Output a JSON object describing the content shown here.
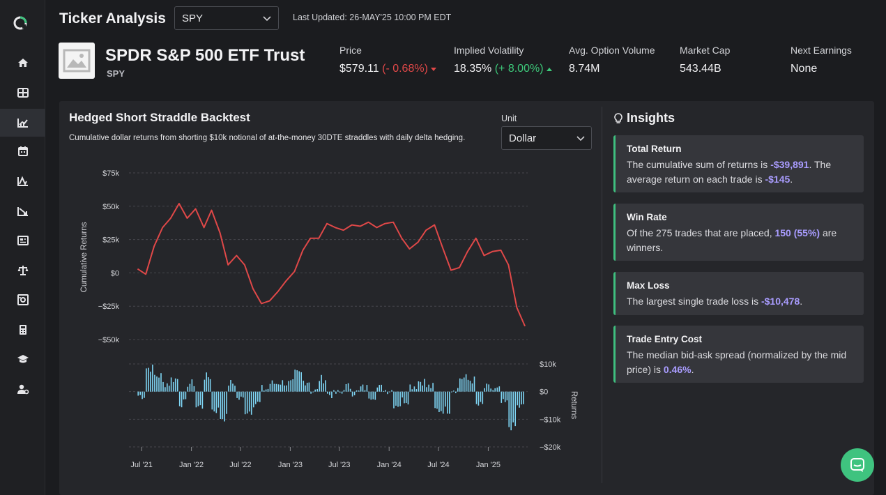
{
  "app": {
    "page_title": "Ticker Analysis",
    "ticker_select": "SPY",
    "last_updated": "Last Updated: 26-MAY'25 10:00 PM EDT"
  },
  "sidebar": {
    "items": [
      {
        "icon": "home-icon"
      },
      {
        "icon": "dashboard-icon"
      },
      {
        "icon": "ticker-analysis-icon",
        "active": true
      },
      {
        "icon": "calendar-icon"
      },
      {
        "icon": "line-chart-icon"
      },
      {
        "icon": "screener-icon"
      },
      {
        "icon": "news-icon"
      },
      {
        "icon": "balance-icon"
      },
      {
        "icon": "portfolio-icon"
      },
      {
        "icon": "calculator-icon"
      },
      {
        "icon": "education-icon"
      },
      {
        "icon": "user-settings-icon"
      }
    ]
  },
  "header": {
    "name": "SPDR S&P 500 ETF Trust",
    "symbol": "SPY",
    "stats": [
      {
        "label": "Price",
        "value": "$579.11",
        "change": "(- 0.68%)",
        "direction": "down"
      },
      {
        "label": "Implied Volatility",
        "value": "18.35%",
        "change": "(+ 8.00%)",
        "direction": "up"
      },
      {
        "label": "Avg. Option Volume",
        "value": "8.74M"
      },
      {
        "label": "Market Cap",
        "value": "543.44B"
      },
      {
        "label": "Next Earnings",
        "value": "None"
      }
    ]
  },
  "backtest": {
    "title": "Hedged Short Straddle Backtest",
    "subtitle": "Cumulative dollar returns from shorting $10k notional of at-the-money 30DTE straddles with daily delta hedging.",
    "unit_label": "Unit",
    "unit_value": "Dollar"
  },
  "chart_data": [
    {
      "type": "line",
      "ylabel": "Cumulative Returns",
      "y_ticks": [
        "$75k",
        "$50k",
        "$25k",
        "$0",
        "−$25k",
        "−$50k"
      ],
      "ylim": [
        -50000,
        75000
      ],
      "x_ticks": [
        "Jul '21",
        "Jan '22",
        "Jul '22",
        "Jan '23",
        "Jul '23",
        "Jan '24",
        "Jul '24",
        "Jan '25"
      ],
      "color": "#e04848",
      "series": [
        {
          "x": [
            "2021-06",
            "2021-07",
            "2021-08",
            "2021-09",
            "2021-10",
            "2021-11",
            "2021-12",
            "2022-01",
            "2022-02",
            "2022-03",
            "2022-04",
            "2022-05",
            "2022-06",
            "2022-07",
            "2022-08",
            "2022-09",
            "2022-10",
            "2022-11",
            "2022-12",
            "2023-01",
            "2023-02",
            "2023-03",
            "2023-04",
            "2023-05",
            "2023-06",
            "2023-07",
            "2023-08",
            "2023-09",
            "2023-10",
            "2023-11",
            "2023-12",
            "2024-01",
            "2024-02",
            "2024-03",
            "2024-04",
            "2024-05",
            "2024-06",
            "2024-07",
            "2024-08",
            "2024-09",
            "2024-10",
            "2024-11",
            "2024-12",
            "2025-01",
            "2025-02",
            "2025-03",
            "2025-04",
            "2025-05"
          ],
          "y": [
            3000,
            -1000,
            20000,
            34000,
            41000,
            52000,
            41000,
            48000,
            34000,
            47000,
            30000,
            6000,
            13000,
            6000,
            -12000,
            -23000,
            -21000,
            -14000,
            -6000,
            1000,
            17000,
            26000,
            26000,
            37000,
            34000,
            32000,
            36000,
            35000,
            38000,
            34000,
            37000,
            38000,
            26000,
            18000,
            23000,
            32000,
            36000,
            19000,
            2000,
            4000,
            16000,
            26000,
            13000,
            16000,
            17000,
            6000,
            -26000,
            -40000
          ]
        }
      ]
    },
    {
      "type": "bar",
      "ylabel": "Returns",
      "y_ticks": [
        "$10k",
        "$0",
        "−$10k",
        "−$20k"
      ],
      "ylim": [
        -20000,
        10000
      ],
      "color": "#7fd6f5"
    }
  ],
  "insights": {
    "title": "Insights",
    "cards": [
      {
        "title": "Total Return",
        "t1": "The cumulative sum of returns is ",
        "v1": "-$39,891",
        "t2": ". The average return on each trade is ",
        "v2": "-$145",
        "t3": "."
      },
      {
        "title": "Win Rate",
        "t1": "Of the 275 trades that are placed, ",
        "v1": "150 (55%)",
        "t2": " are winners."
      },
      {
        "title": "Max Loss",
        "t1": "The largest single trade loss is ",
        "v1": "-$10,478",
        "t2": "."
      },
      {
        "title": "Trade Entry Cost",
        "t1": "The median bid-ask spread (normalized by the mid price) is ",
        "v1": "0.46%",
        "t2": "."
      }
    ]
  }
}
